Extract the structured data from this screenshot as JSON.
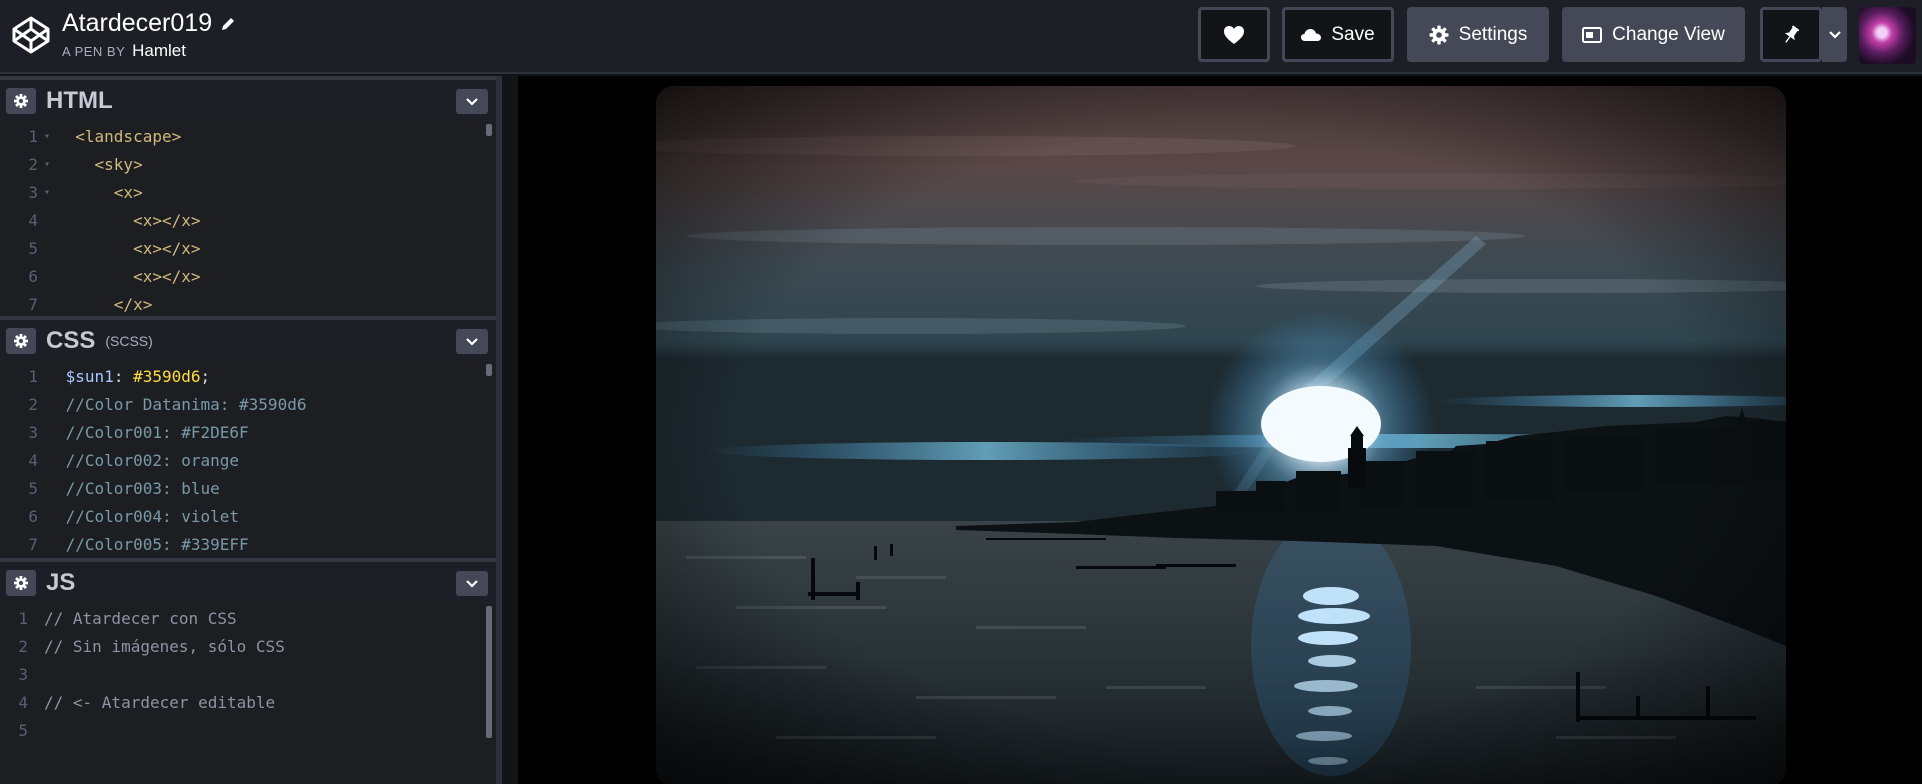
{
  "header": {
    "title": "Atardecer019",
    "byline_prefix": "A PEN BY",
    "author": "Hamlet",
    "save_label": "Save",
    "settings_label": "Settings",
    "change_view_label": "Change View"
  },
  "panels": {
    "html": {
      "title": "HTML",
      "lines": [
        {
          "n": "1",
          "fold": "▾",
          "code": "  <landscape>"
        },
        {
          "n": "2",
          "fold": "▾",
          "code": "    <sky>"
        },
        {
          "n": "3",
          "fold": "▾",
          "code": "      <x>"
        },
        {
          "n": "4",
          "fold": "",
          "code": "        <x></x>"
        },
        {
          "n": "5",
          "fold": "",
          "code": "        <x></x>"
        },
        {
          "n": "6",
          "fold": "",
          "code": "        <x></x>"
        },
        {
          "n": "7",
          "fold": "",
          "code": "      </x>"
        }
      ]
    },
    "css": {
      "title": "CSS",
      "subtitle": "(SCSS)",
      "var_name": "$sun1",
      "var_value": "#3590d6",
      "lines": [
        {
          "n": "1",
          "code": "$sun1: #3590d6;"
        },
        {
          "n": "2",
          "code": "//Color Datanima: #3590d6"
        },
        {
          "n": "3",
          "code": "//Color001: #F2DE6F"
        },
        {
          "n": "4",
          "code": "//Color002: orange"
        },
        {
          "n": "5",
          "code": "//Color003: blue"
        },
        {
          "n": "6",
          "code": "//Color004: violet"
        },
        {
          "n": "7",
          "code": "//Color005: #339EFF"
        }
      ]
    },
    "js": {
      "title": "JS",
      "lines": [
        {
          "n": "1",
          "code": "// Atardecer con CSS"
        },
        {
          "n": "2",
          "code": "// Sin imágenes, sólo CSS"
        },
        {
          "n": "3",
          "code": ""
        },
        {
          "n": "4",
          "code": "// <- Atardecer editable"
        },
        {
          "n": "5",
          "code": ""
        }
      ]
    }
  },
  "icons": {
    "logo": "codepen-logo-icon",
    "edit": "pencil-icon",
    "heart": "heart-icon",
    "save": "cloud-icon",
    "settings": "gear-icon",
    "change_view": "layout-icon",
    "pin": "pin-icon",
    "dropdown": "chevron-down-icon",
    "panel_settings": "gear-icon",
    "collapse": "chevron-down-icon"
  },
  "colors": {
    "sun": "#3590d6",
    "header_bg": "#1e1f26",
    "button": "#444857"
  }
}
